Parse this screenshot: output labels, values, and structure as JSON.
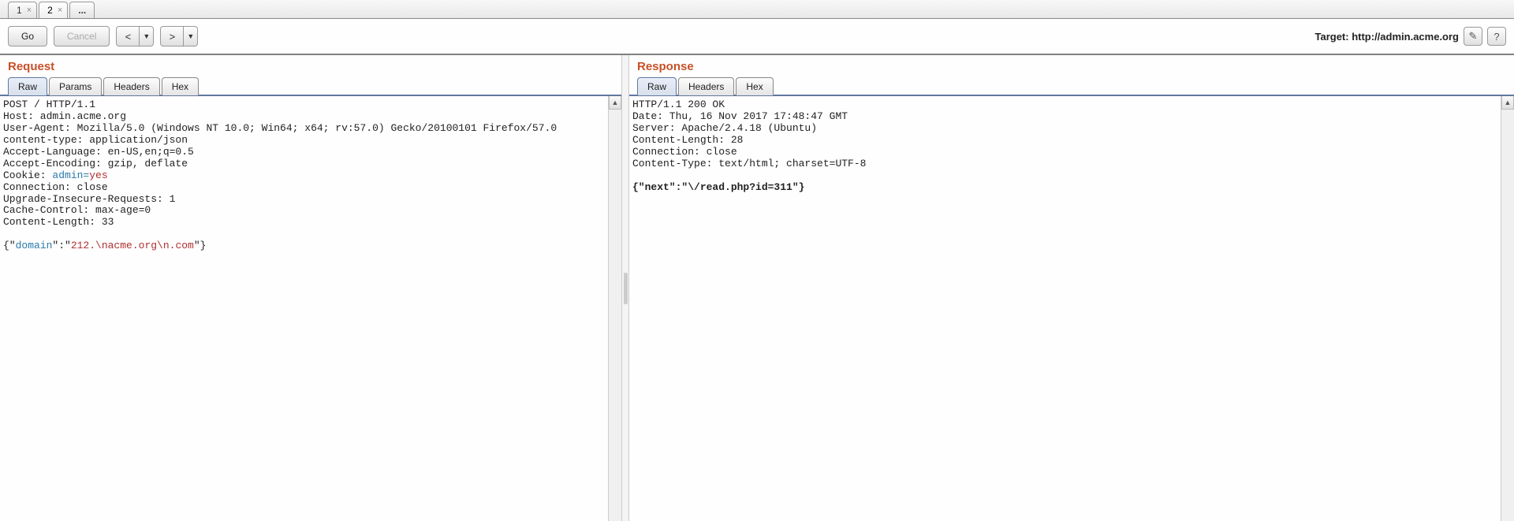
{
  "tabs": [
    {
      "label": "1"
    },
    {
      "label": "2"
    },
    {
      "more": "..."
    }
  ],
  "toolbar": {
    "go": "Go",
    "cancel": "Cancel",
    "prev": "<",
    "prev_drop": "▼",
    "next": ">",
    "next_drop": "▼",
    "target_prefix": "Target: ",
    "target_url": "http://admin.acme.org",
    "edit_icon": "✎",
    "help_icon": "?"
  },
  "request": {
    "title": "Request",
    "tabs": [
      "Raw",
      "Params",
      "Headers",
      "Hex"
    ],
    "line1": "POST / HTTP/1.1",
    "line2": "Host: admin.acme.org",
    "line3": "User-Agent: Mozilla/5.0 (Windows NT 10.0; Win64; x64; rv:57.0) Gecko/20100101 Firefox/57.0",
    "line4": "content-type: application/json",
    "line5": "Accept-Language: en-US,en;q=0.5",
    "line6": "Accept-Encoding: gzip, deflate",
    "cookie_prefix": "Cookie: ",
    "cookie_key": "admin=",
    "cookie_val": "yes",
    "line8": "Connection: close",
    "line9": "Upgrade-Insecure-Requests: 1",
    "line10": "Cache-Control: max-age=0",
    "line11": "Content-Length: 33",
    "body_open": "{\"",
    "body_key": "domain",
    "body_mid": "\":\"",
    "body_val": "212.\\nacme.org\\n.com",
    "body_close": "\"}"
  },
  "response": {
    "title": "Response",
    "tabs": [
      "Raw",
      "Headers",
      "Hex"
    ],
    "line1": "HTTP/1.1 200 OK",
    "line2": "Date: Thu, 16 Nov 2017 17:48:47 GMT",
    "line3": "Server: Apache/2.4.18 (Ubuntu)",
    "line4": "Content-Length: 28",
    "line5": "Connection: close",
    "line6": "Content-Type: text/html; charset=UTF-8",
    "body": "{\"next\":\"\\/read.php?id=311\"}"
  }
}
